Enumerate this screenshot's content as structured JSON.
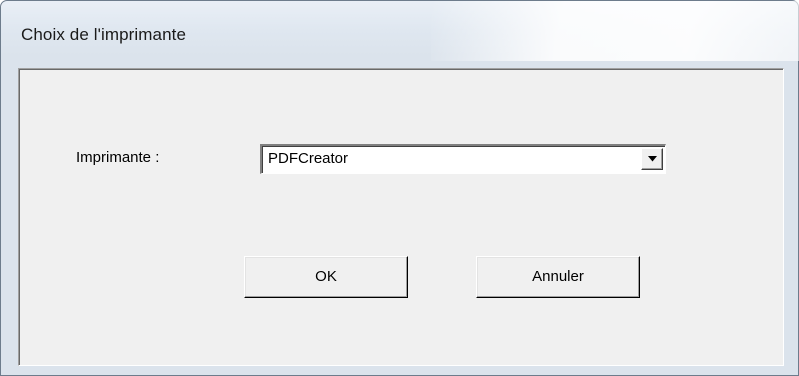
{
  "window": {
    "title": "Choix de l'imprimante"
  },
  "form": {
    "printer_label": "Imprimante :",
    "printer_selected": "PDFCreator",
    "dropdown_icon": "chevron-down-icon"
  },
  "buttons": {
    "ok_label": "OK",
    "cancel_label": "Annuler"
  },
  "colors": {
    "dialog_background": "#f0f0f0",
    "title_bar": "#dfe7f0"
  }
}
